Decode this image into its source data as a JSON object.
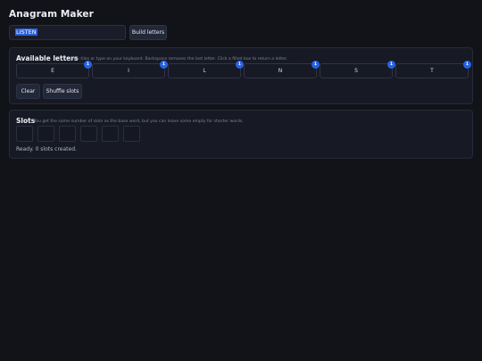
{
  "app": {
    "title": "Anagram Maker"
  },
  "word_input": {
    "value": "LISTEN"
  },
  "buttons": {
    "build": "Build letters",
    "clear": "Clear",
    "shuffle": "Shuffle slots"
  },
  "letters_panel": {
    "title": "Available letters",
    "hint": "Click tiles or type on your keyboard. Backspace removes the last letter. Click a filled box to return a letter.",
    "tiles": [
      {
        "letter": "E",
        "count": "1"
      },
      {
        "letter": "I",
        "count": "1"
      },
      {
        "letter": "L",
        "count": "1"
      },
      {
        "letter": "N",
        "count": "1"
      },
      {
        "letter": "S",
        "count": "1"
      },
      {
        "letter": "T",
        "count": "1"
      }
    ]
  },
  "slots_panel": {
    "title": "Slots",
    "hint": "You get the same number of slots as the base word, but you can leave some empty for shorter words.",
    "slot_count": 6,
    "slots": [
      "",
      "",
      "",
      "",
      "",
      ""
    ],
    "status": "Ready. 0 slots created."
  },
  "colors": {
    "background": "#121318",
    "panel": "#171a25",
    "accent": "#2563eb",
    "selection": "#2a5fd6"
  }
}
